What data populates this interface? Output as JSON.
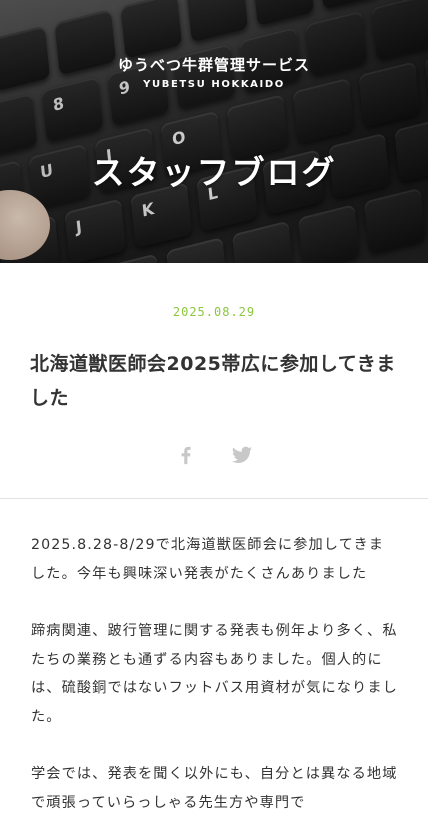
{
  "header": {
    "brand_name": "ゆうべつ牛群管理サービス",
    "brand_sub": "YUBETSU HOKKAIDO",
    "page_title": "スタッフブログ"
  },
  "post": {
    "date": "2025.08.29",
    "title": "北海道獣医師会2025帯広に参加してきました",
    "paragraphs": [
      "2025.8.28-8/29で北海道獣医師会に参加してきました。今年も興味深い発表がたくさんありました",
      "蹄病関連、跛行管理に関する発表も例年より多く、私たちの業務とも通ずる内容もありました。個人的には、硫酸銅ではないフットバス用資材が気になりました。",
      "学会では、発表を聞く以外にも、自分とは異なる地域で頑張っていらっしゃる先生方や専門で"
    ]
  },
  "share": {
    "icons": [
      "facebook-icon",
      "twitter-icon"
    ]
  },
  "colors": {
    "date_accent": "#8cc63f",
    "text": "#333333",
    "icon": "#c8c8c8"
  }
}
